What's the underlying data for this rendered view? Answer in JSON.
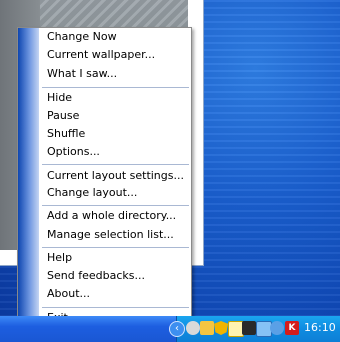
{
  "menu": {
    "items": [
      {
        "label": "Change Now"
      },
      {
        "label": "Current wallpaper..."
      },
      {
        "label": "What I saw..."
      },
      {
        "label": "Hide"
      },
      {
        "label": "Pause"
      },
      {
        "label": "Shuffle"
      },
      {
        "label": "Options..."
      },
      {
        "label": "Current layout settings..."
      },
      {
        "label": "Change layout..."
      },
      {
        "label": "Add a whole directory..."
      },
      {
        "label": "Manage selection list..."
      },
      {
        "label": "Help"
      },
      {
        "label": "Send feedbacks..."
      },
      {
        "label": "About..."
      },
      {
        "label": "Exit"
      }
    ]
  },
  "taskbar": {
    "clock": "16:10",
    "tray_icons": [
      "tray-chevron-icon",
      "cd-icon",
      "network-icon",
      "shield-icon",
      "notepad-icon",
      "image-icon",
      "monitor-icon",
      "refresh-icon",
      "antivirus-k-icon"
    ]
  }
}
